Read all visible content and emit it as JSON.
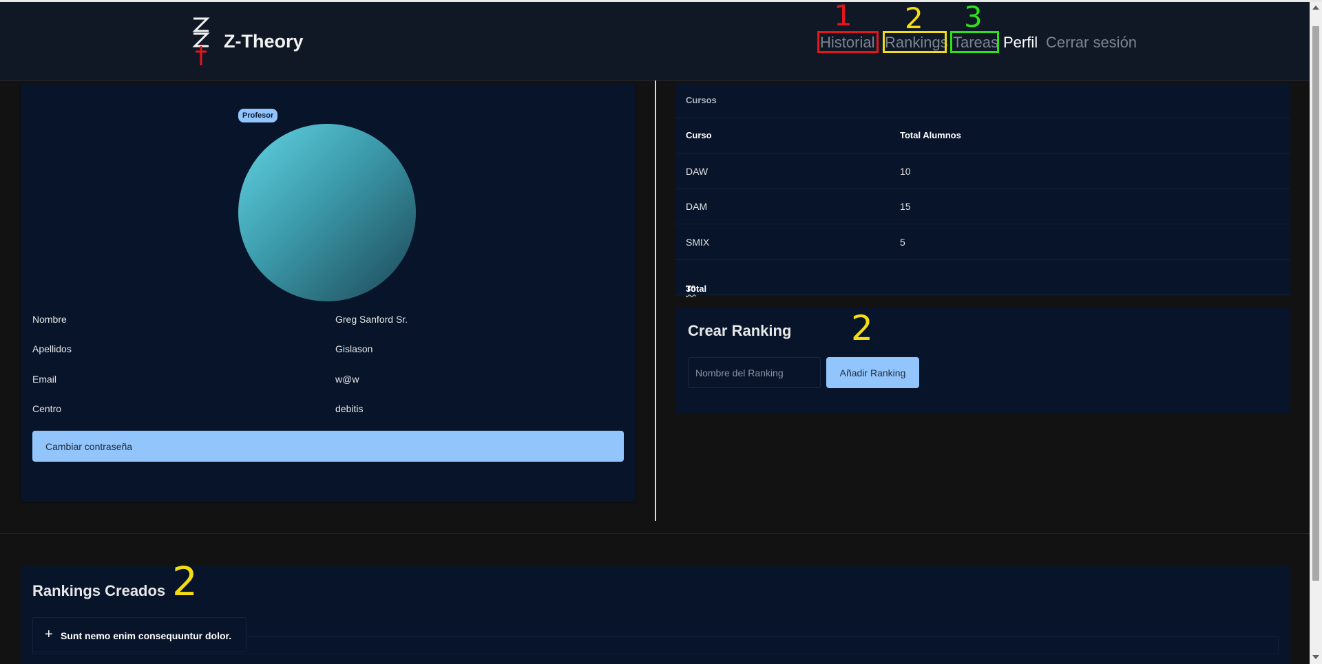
{
  "app": {
    "name": "Z-Theory"
  },
  "nav": {
    "items": [
      {
        "label": "Historial"
      },
      {
        "label": "Rankings"
      },
      {
        "label": "Tareas"
      },
      {
        "label": "Perfil"
      },
      {
        "label": "Cerrar sesión"
      }
    ],
    "active": "Perfil"
  },
  "annotations": {
    "nav_numbers": [
      "1",
      "2",
      "3"
    ],
    "section_number": "2",
    "colors": {
      "red": "#e5161b",
      "yellow": "#f2de12",
      "green": "#2ee21a"
    }
  },
  "profile": {
    "role_badge": "Profesor",
    "fields": [
      {
        "label": "Nombre",
        "value": "Greg Sanford Sr."
      },
      {
        "label": "Apellidos",
        "value": "Gislason"
      },
      {
        "label": "Email",
        "value": "w@w"
      },
      {
        "label": "Centro",
        "value": "debitis"
      }
    ],
    "change_password_label": "Cambiar contraseña"
  },
  "courses": {
    "title": "Cursos",
    "columns": [
      "Curso",
      "Total Alumnos"
    ],
    "rows": [
      {
        "course": "DAW",
        "students": "10"
      },
      {
        "course": "DAM",
        "students": "15"
      },
      {
        "course": "SMIX",
        "students": "5"
      }
    ],
    "total_label": "Total",
    "total_value": "30"
  },
  "create_ranking": {
    "title": "Crear Ranking",
    "input_placeholder": "Nombre del Ranking",
    "button_label": "Añadir Ranking"
  },
  "rankings_created": {
    "title": "Rankings Creados",
    "items": [
      {
        "label": "Sunt nemo enim consequuntur dolor."
      }
    ]
  },
  "theme": {
    "accent": "#93c5fd",
    "card_bg": "#07142a",
    "page_bg": "#121212",
    "navbar_bg": "#101826"
  }
}
